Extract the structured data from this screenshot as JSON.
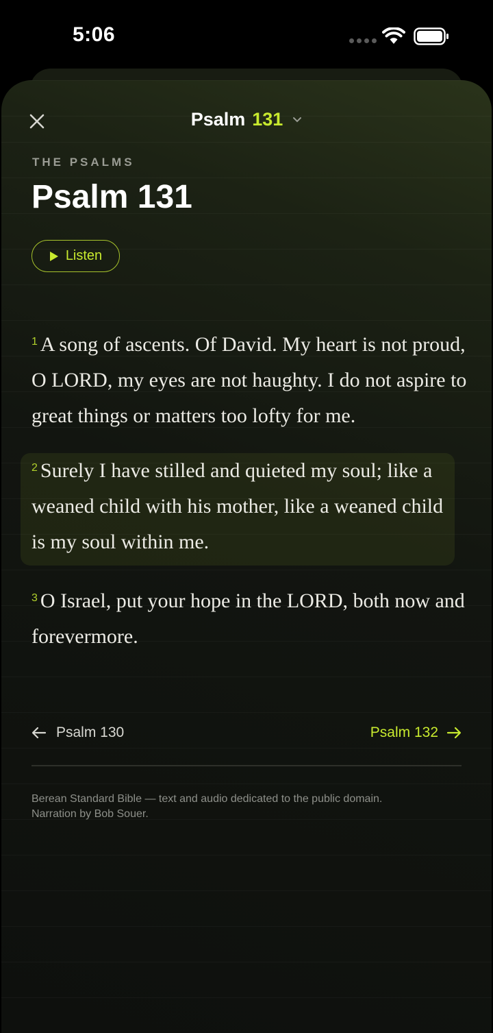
{
  "status_bar": {
    "time": "5:06"
  },
  "nav": {
    "book": "Psalm",
    "chapter": "131"
  },
  "header": {
    "book_label": "THE PSALMS",
    "title": "Psalm 131",
    "listen_label": "Listen"
  },
  "verses": [
    {
      "number": "1",
      "text": "A song of ascents. Of David. My heart is not proud, O LORD, my eyes are not haughty. I do not aspire to great things or matters too lofty for me."
    },
    {
      "number": "2",
      "text": "Surely I have stilled and quieted my soul; like a weaned child with his mother, like a weaned child is my soul within me."
    },
    {
      "number": "3",
      "text": "O Israel, put your hope in the LORD, both now and forevermore."
    }
  ],
  "chapter_nav": {
    "prev_label": "Psalm 130",
    "next_label": "Psalm 132"
  },
  "footer": {
    "line1": "Berean Standard Bible — text and audio dedicated to the public domain.",
    "line2": "Narration by Bob Souer."
  },
  "colors": {
    "accent": "#c8ea2e",
    "background": "#000000"
  },
  "icons": {
    "close": "close-icon",
    "chevron": "chevron-down-icon",
    "play": "play-icon",
    "prev": "arrow-left-icon",
    "next": "arrow-right-icon"
  }
}
